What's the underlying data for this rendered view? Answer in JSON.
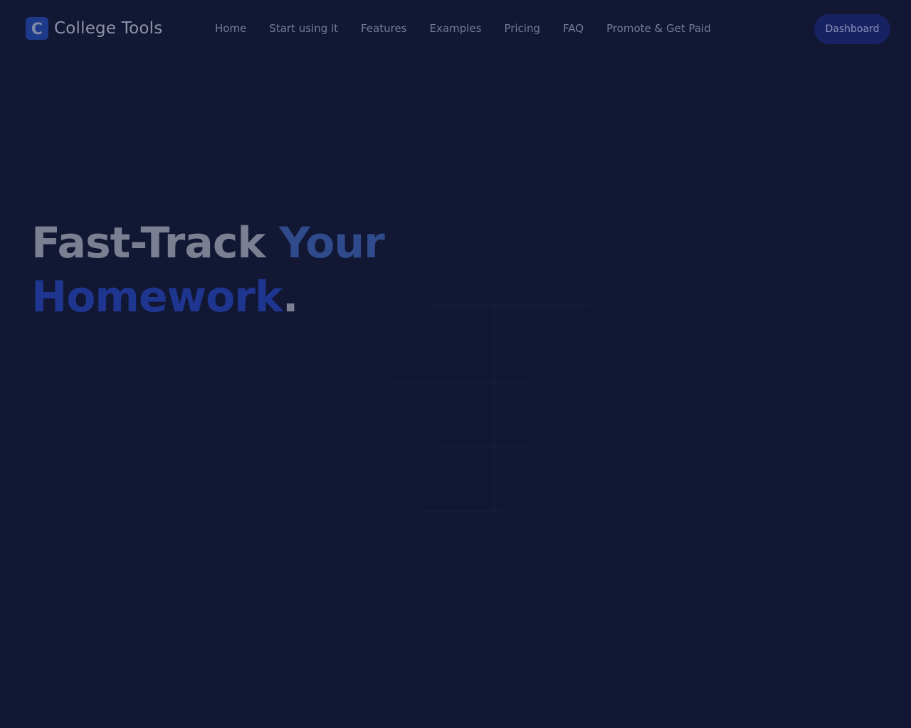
{
  "header": {
    "logo_letter": "C",
    "brand": "College Tools",
    "nav": [
      "Home",
      "Start using it",
      "Features",
      "Examples",
      "Pricing",
      "FAQ",
      "Promote & Get Paid"
    ],
    "dashboard_label": "Dashboard"
  },
  "hero": {
    "title_part1": "Fast-Track ",
    "title_part2": "Your",
    "title_part3": "Homework",
    "title_part4": "."
  },
  "colors": {
    "background": "#121733",
    "accent": "#1f3690",
    "button_bg": "#172263"
  }
}
